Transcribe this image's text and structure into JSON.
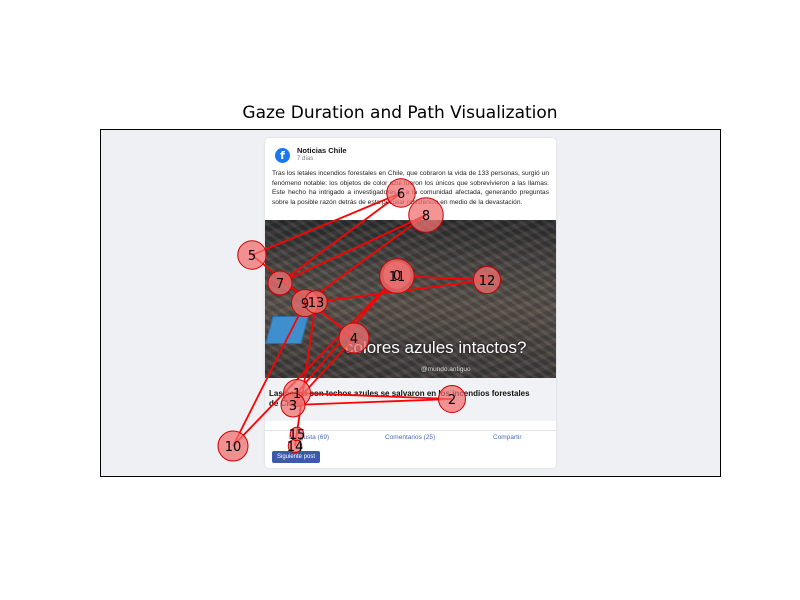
{
  "title": "Gaze Duration and Path Visualization",
  "post": {
    "page_name": "Noticias Chile",
    "time": "7 días",
    "text": "Tras los letales incendios forestales en Chile, que cobraron la vida de 133 personas, surgió un fenómeno notable: los objetos de color azul fueron los únicos que sobrevivieron a las llamas. Este hecho ha intrigado a investigadores y a la comunidad afectada, generando preguntas sobre la posible razón detrás de esta peculiar resistencia en medio de la devastación.",
    "image_caption": "colores azules intactos?",
    "image_watermark": "@mundo.antiguo",
    "link_title": "Las casas con techos azules se salvaron en los incendios forestales de Chile",
    "like_label": "Me gusta (69)",
    "comment_label": "Comentarios (25)",
    "share_label": "Compartir",
    "next_label": "Siguiente post"
  },
  "colors": {
    "path": "#ff0000",
    "fixation_fill": "#f07070",
    "fixation_edge": "#cc0000",
    "background": "#eef0f4"
  },
  "chart_data": {
    "type": "scatter",
    "title": "Gaze Duration and Path Visualization",
    "xlabel": "",
    "ylabel": "",
    "xlim": [
      0,
      800
    ],
    "ylim": [
      600,
      0
    ],
    "grid": false,
    "fixations": [
      {
        "label": "0",
        "x": 397,
        "y": 275,
        "duration": 11
      },
      {
        "label": "1",
        "x": 297,
        "y": 393,
        "duration": 10
      },
      {
        "label": "2",
        "x": 452,
        "y": 399,
        "duration": 10
      },
      {
        "label": "3",
        "x": 293,
        "y": 405,
        "duration": 8
      },
      {
        "label": "4",
        "x": 354,
        "y": 338,
        "duration": 12
      },
      {
        "label": "5",
        "x": 252,
        "y": 255,
        "duration": 11
      },
      {
        "label": "6",
        "x": 401,
        "y": 193,
        "duration": 11
      },
      {
        "label": "7",
        "x": 280,
        "y": 283,
        "duration": 8
      },
      {
        "label": "8",
        "x": 426,
        "y": 215,
        "duration": 15
      },
      {
        "label": "9",
        "x": 305,
        "y": 303,
        "duration": 10
      },
      {
        "label": "10",
        "x": 233,
        "y": 446,
        "duration": 12
      },
      {
        "label": "11",
        "x": 397,
        "y": 276,
        "duration": 15
      },
      {
        "label": "12",
        "x": 487,
        "y": 280,
        "duration": 10
      },
      {
        "label": "13",
        "x": 316,
        "y": 302,
        "duration": 7
      },
      {
        "label": "14",
        "x": 295,
        "y": 446,
        "duration": 1
      },
      {
        "label": "15",
        "x": 297,
        "y": 434,
        "duration": 1
      }
    ]
  }
}
